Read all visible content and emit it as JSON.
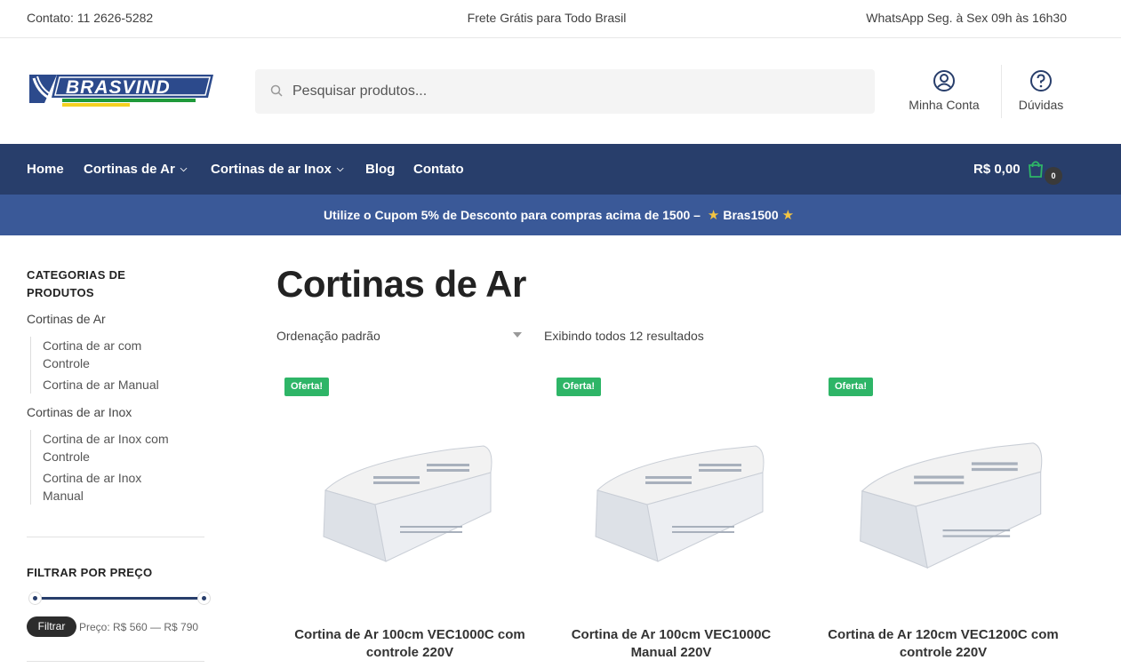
{
  "topbar": {
    "contact": "Contato: 11 2626-5282",
    "shipping": "Frete Grátis para Todo Brasil",
    "whatsapp": "WhatsApp Seg. à Sex 09h às 16h30"
  },
  "header": {
    "logo_text": "BRASVIND",
    "search_placeholder": "Pesquisar produtos...",
    "account_label": "Minha Conta",
    "faq_label": "Dúvidas"
  },
  "nav": {
    "items": [
      {
        "label": "Home"
      },
      {
        "label": "Cortinas de Ar"
      },
      {
        "label": "Cortinas de ar Inox"
      },
      {
        "label": "Blog"
      },
      {
        "label": "Contato"
      }
    ],
    "cart_total": "R$ 0,00",
    "cart_count": "0"
  },
  "promo": {
    "text": "Utilize o Cupom 5% de Desconto para compras acima de 1500 –",
    "code": "Bras1500"
  },
  "sidebar": {
    "categories_title_line1": "CATEGORIAS DE",
    "categories_title_line2": "PRODUTOS",
    "categories": [
      {
        "label": "Cortinas de Ar",
        "children": [
          "Cortina de ar com Controle",
          "Cortina de ar Manual"
        ]
      },
      {
        "label": "Cortinas de ar Inox",
        "children": [
          "Cortina de ar Inox com Controle",
          "Cortina de ar Inox Manual"
        ]
      }
    ],
    "filter_title": "FILTRAR POR PREÇO",
    "filter_button": "Filtrar",
    "price_range_label": "Preço: R$ 560 — R$ 790"
  },
  "main": {
    "title": "Cortinas de Ar",
    "sort_selected": "Ordenação padrão",
    "result_count": "Exibindo todos 12 resultados",
    "products": [
      {
        "badge": "Oferta!",
        "title": "Cortina de Ar 100cm VEC1000C com controle 220V"
      },
      {
        "badge": "Oferta!",
        "title": "Cortina de Ar 100cm VEC1000C Manual 220V"
      },
      {
        "badge": "Oferta!",
        "title": "Cortina de Ar 120cm VEC1200C com controle 220V"
      }
    ]
  },
  "colors": {
    "nav_bg": "#283e6b",
    "promo_bg": "#3a5998",
    "badge_green": "#2eb567",
    "cart_icon_green": "#2eb567"
  },
  "icons": [
    "search-icon",
    "user-icon",
    "question-icon",
    "shopping-bag-icon",
    "star-icon",
    "chevron-down-icon"
  ]
}
